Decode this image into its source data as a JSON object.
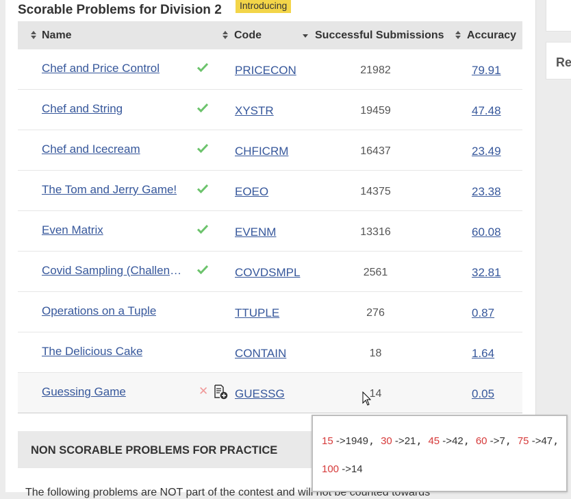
{
  "page_title": "Scorable Problems for Division 2",
  "badge": "Introducing",
  "side_panel_text": "Re",
  "table": {
    "headers": {
      "name": "Name",
      "code": "Code",
      "successful": "Successful Submissions",
      "accuracy": "Accuracy"
    },
    "rows": [
      {
        "name": "Chef and Price Control",
        "code": "PRICECON",
        "submissions": "21982",
        "accuracy": "79.91",
        "status": "solved"
      },
      {
        "name": "Chef and String",
        "code": "XYSTR",
        "submissions": "19459",
        "accuracy": "47.48",
        "status": "solved"
      },
      {
        "name": "Chef and Icecream",
        "code": "CHFICRM",
        "submissions": "16437",
        "accuracy": "23.49",
        "status": "solved"
      },
      {
        "name": "The Tom and Jerry Game!",
        "code": "EOEO",
        "submissions": "14375",
        "accuracy": "23.38",
        "status": "solved"
      },
      {
        "name": "Even Matrix",
        "code": "EVENM",
        "submissions": "13316",
        "accuracy": "60.08",
        "status": "solved"
      },
      {
        "name": "Covid Sampling (Challenge)",
        "code": "COVDSMPL",
        "submissions": "2561",
        "accuracy": "32.81",
        "status": "solved"
      },
      {
        "name": "Operations on a Tuple",
        "code": "TTUPLE",
        "submissions": "276",
        "accuracy": "0.87",
        "status": "none"
      },
      {
        "name": "The Delicious Cake",
        "code": "CONTAIN",
        "submissions": "18",
        "accuracy": "1.64",
        "status": "none"
      },
      {
        "name": "Guessing Game",
        "code": "GUESSG",
        "submissions": "14",
        "accuracy": "0.05",
        "status": "wrong"
      }
    ]
  },
  "section_title": "NON SCORABLE PROBLEMS FOR PRACTICE",
  "bottom_text": "The following problems are NOT part of the contest and will not be counted towards",
  "popup": {
    "entries": [
      {
        "key": "15",
        "value": "1949"
      },
      {
        "key": "30",
        "value": "21"
      },
      {
        "key": "45",
        "value": "42"
      },
      {
        "key": "60",
        "value": "7"
      },
      {
        "key": "75",
        "value": "47"
      },
      {
        "key": "100",
        "value": "14"
      }
    ]
  },
  "icons": {
    "solved": "check-icon",
    "wrong": "cross-icon",
    "submit": "document-add-icon",
    "sort": "sort-icon"
  },
  "colors": {
    "link": "#36579b",
    "check": "#6cc36c",
    "cross": "#f09a9a",
    "badge": "#f3d549",
    "popup_number": "#d63a3a"
  }
}
